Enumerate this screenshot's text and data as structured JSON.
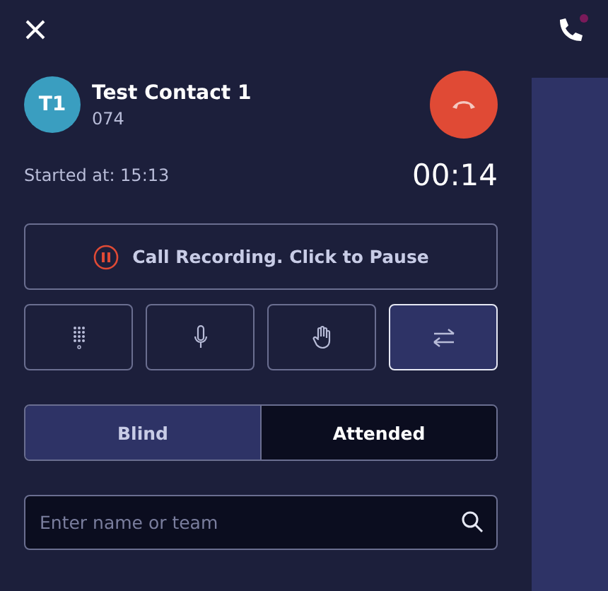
{
  "contact": {
    "initials": "T1",
    "name": "Test Contact 1",
    "number": "074"
  },
  "call": {
    "started": "Started at: 15:13",
    "duration": "00:14"
  },
  "recording": {
    "label": "Call Recording. Click to Pause"
  },
  "controls": [
    {
      "kind": "keypad",
      "selected": false
    },
    {
      "kind": "mic",
      "selected": false
    },
    {
      "kind": "hold",
      "selected": false
    },
    {
      "kind": "transfer",
      "selected": true
    }
  ],
  "transfer_tabs": [
    {
      "label": "Blind",
      "selected": true
    },
    {
      "label": "Attended",
      "selected": false
    }
  ],
  "search": {
    "placeholder": "Enter name or team"
  },
  "phone_indicator": {
    "color": "#7a1a5a"
  }
}
